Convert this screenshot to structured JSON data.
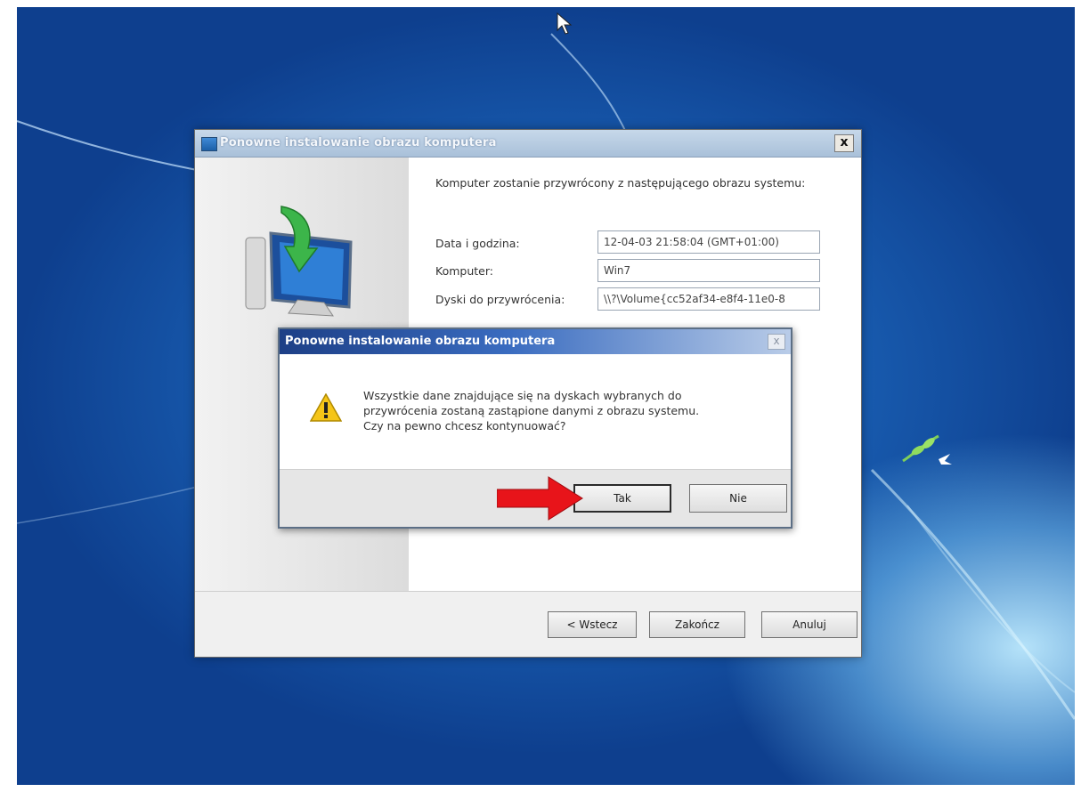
{
  "wizard": {
    "title": "Ponowne instalowanie obrazu komputera",
    "close": "x",
    "intro": "Komputer zostanie przywrócony z następującego obrazu systemu:",
    "fields": {
      "date_label": "Data i godzina:",
      "date_value": "12-04-03 21:58:04 (GMT+01:00)",
      "computer_label": "Komputer:",
      "computer_value": "Win7",
      "disks_label": "Dyski do przywrócenia:",
      "disks_value": "\\\\?\\Volume{cc52af34-e8f4-11e0-8"
    },
    "buttons": {
      "back": "< Wstecz",
      "finish": "Zakończ",
      "cancel": "Anuluj"
    }
  },
  "dialog": {
    "title": "Ponowne instalowanie obrazu komputera",
    "close": "x",
    "message_line1": "Wszystkie dane znajdujące się na dyskach wybranych do",
    "message_line2": "przywrócenia zostaną zastąpione danymi z obrazu systemu.",
    "message_line3": "Czy na pewno chcesz kontynuować?",
    "buttons": {
      "yes": "Tak",
      "no": "Nie"
    }
  },
  "icons": {
    "warning": "warning-icon",
    "annotation_arrow": "red-arrow-icon",
    "mouse_cursor": "cursor-icon"
  },
  "colors": {
    "annotation_arrow": "#e8141a",
    "desktop_blue": "#1b63b8"
  }
}
